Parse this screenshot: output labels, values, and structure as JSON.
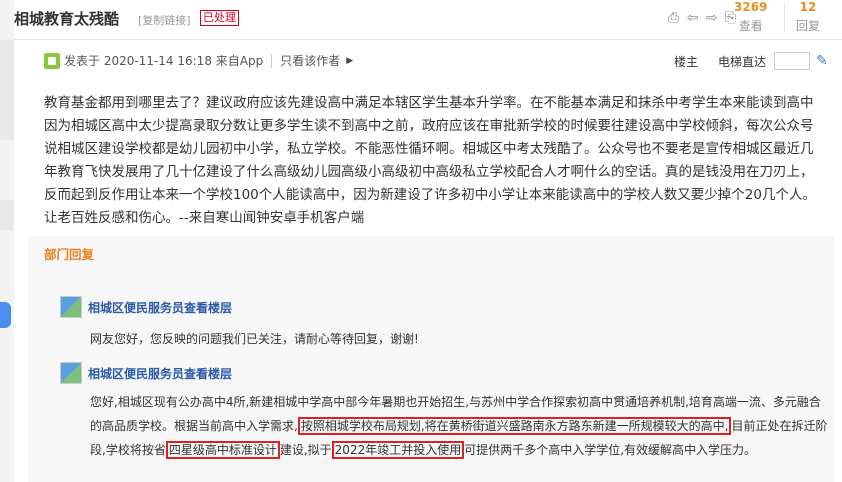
{
  "header": {
    "title": "相城教育太残酷",
    "copy_link": "[复制链接]",
    "status": "已处理",
    "views_count": "3269",
    "views_label": "查看",
    "replies_count": "12",
    "replies_label": "回复",
    "icons": [
      "print-icon",
      "prev-icon",
      "next-icon",
      "share-icon"
    ]
  },
  "post": {
    "meta": "发表于 2020-11-14 16:18 来自App",
    "only_author": "只看该作者",
    "floor_label": "楼主",
    "jump_label": "电梯直达",
    "body": "教育基金都用到哪里去了？建议政府应该先建设高中满足本辖区学生基本升学率。在不能基本满足和抹杀中考学生本来能读到高中因为相城区高中太少提高录取分数让更多学生读不到高中之前，政府应该在审批新学校的时候要往建设高中学校倾斜，每次公众号说相城区建设学校都是幼儿园初中小学，私立学校。不能恶性循环啊。相城区中考太残酷了。公众号也不要老是宣传相城区最近几年教育飞快发展用了几十亿建设了什么高级幼儿园高级小高级初中高级私立学校配合人才啊什么的空话。真的是钱没用在刀刃上，反而起到反作用让本来一个学校100个人能读高中，因为新建设了许多初中小学让本来能读高中的学校人数又要少掉个20几个人。让老百姓反感和伤心。--来自寒山闻钟安卓手机客户端"
  },
  "department": {
    "title": "部门回复",
    "reply1": {
      "name": "相城区便民服务员查看楼层",
      "text": "网友您好，您反映的问题我们已关注，请耐心等待回复，谢谢!"
    },
    "reply2": {
      "name": "相城区便民服务员查看楼层",
      "part1": "您好,相城区现有公办高中4所,新建相城中学高中部今年暑期也开始招生,与苏州中学合作探索初高中贯通培养机制,培育高端一流、多元融合的高品质学校。根据当前高中入学需求,",
      "hl1": "按照相城学校布局规划,将在黄桥街道兴盛路南永方路东新建一所规模较大的高中,",
      "part2": "目前正处在拆迁阶段,学校将按省",
      "hl2": "四星级高中标准设计",
      "part3": "建设,拟于",
      "hl3": "2022年竣工并投入使用",
      "part4": "可提供两千多个高中入学学位,有效缓解高中入学压力。"
    }
  },
  "colors": {
    "accent_orange": "#e9801f",
    "link_blue": "#2a5aa8",
    "highlight_red": "#e02020",
    "badge_red": "#d0021b"
  }
}
